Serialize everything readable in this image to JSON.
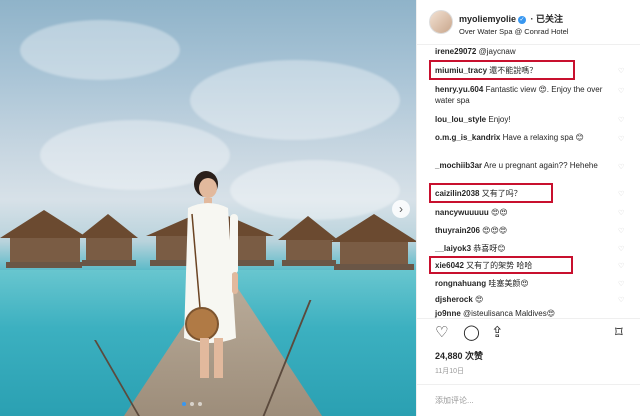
{
  "header": {
    "username": "myoliemyolie",
    "follow_label": "· 已关注",
    "location": "Over Water Spa @ Conrad Hotel"
  },
  "comments": [
    {
      "user": "irene29072",
      "text": "@jaycnaw"
    },
    {
      "user": "miumiu_tracy",
      "text": "還不能說嗎？",
      "highlight": true
    },
    {
      "user": "henry.yu.604",
      "text": "Fantastic view 😍. Enjoy the over water spa"
    },
    {
      "user": "lou_lou_style",
      "text": "Enjoy!"
    },
    {
      "user": "o.m.g_is_kandrix",
      "text": "Have a relaxing spa 😊"
    },
    {
      "user": "_mochiib3ar",
      "text": "Are u pregnant again?? Hehehe"
    },
    {
      "user": "caizilin2038",
      "text": "又有了吗？",
      "highlight": true
    },
    {
      "user": "nancywuuuuu",
      "text": "😍😍"
    },
    {
      "user": "thuyrain206",
      "text": "😍😍😍"
    },
    {
      "user": "__laiyok3",
      "text": "恭喜呀😊"
    },
    {
      "user": "xie6042",
      "text": "又有了的架势 哈哈",
      "highlight": true
    },
    {
      "user": "rongnahuang",
      "text": "哇塞美颜😍"
    },
    {
      "user": "djsherock",
      "text": "😍"
    },
    {
      "user": "jo9nne",
      "text": "@isteulisanca Maldives😍"
    }
  ],
  "actions": {
    "like_icon": "heart-icon",
    "comment_icon": "comment-icon",
    "share_icon": "share-icon",
    "save_icon": "bookmark-icon"
  },
  "likes": "24,880 次赞",
  "date": "11月10日",
  "add_comment_placeholder": "添加评论...",
  "colors": {
    "highlight_border": "#c8102e",
    "verified_blue": "#3897f0"
  }
}
